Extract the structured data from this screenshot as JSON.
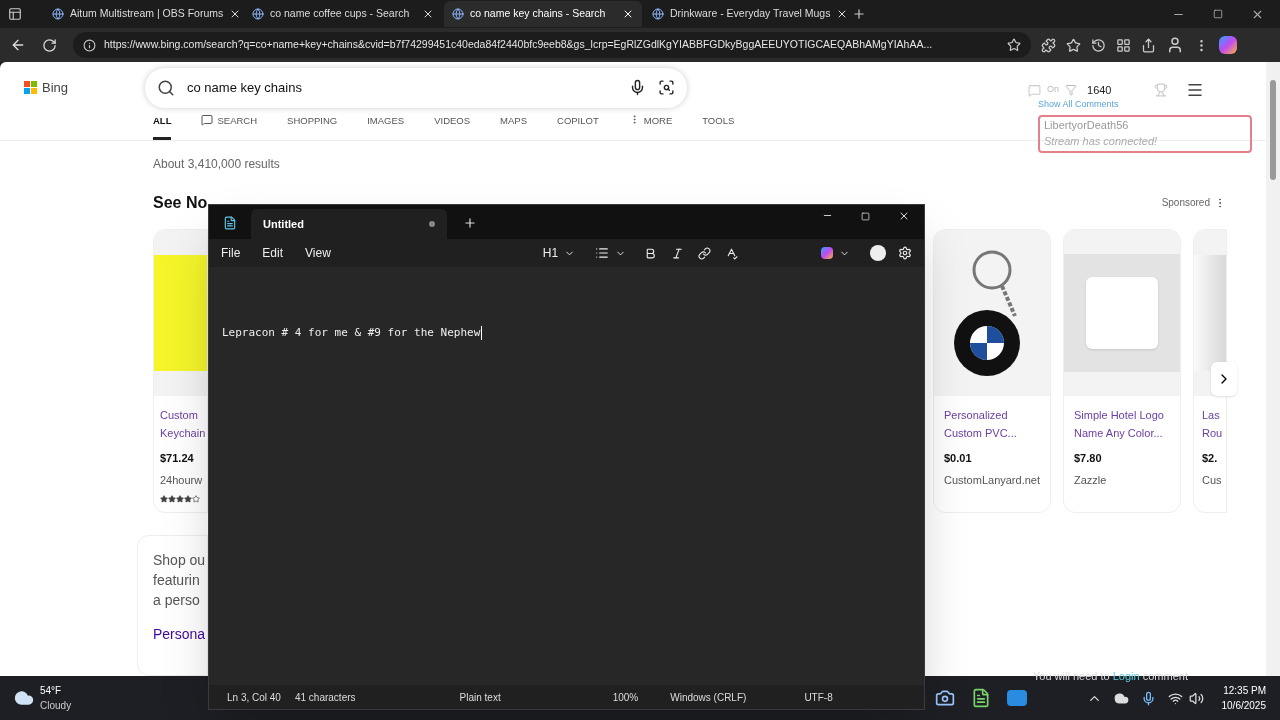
{
  "browser": {
    "tabs": [
      {
        "title": "Aitum Multistream | OBS Forums",
        "selected": false
      },
      {
        "title": "co name coffee cups - Search",
        "selected": false
      },
      {
        "title": "co name key chains - Search",
        "selected": true
      },
      {
        "title": "Drinkware - Everyday Travel Mugs",
        "selected": false
      }
    ],
    "url": "https://www.bing.com/search?q=co+name+key+chains&cvid=b7f74299451c40eda84f2440bfc9eeb8&gs_lcrp=EgRlZGdlKgYIABBFGDkyBggAEEUYOTIGCAEQABhAMgYIAhAA..."
  },
  "bing": {
    "logo": "Bing",
    "query": "co name key chains",
    "nav": [
      {
        "label": "ALL",
        "selected": true
      },
      {
        "label": "SEARCH",
        "selected": false
      },
      {
        "label": "SHOPPING",
        "selected": false
      },
      {
        "label": "IMAGES",
        "selected": false
      },
      {
        "label": "VIDEOS",
        "selected": false
      },
      {
        "label": "MAPS",
        "selected": false
      },
      {
        "label": "COPILOT",
        "selected": false
      },
      {
        "label": "MORE",
        "selected": false
      },
      {
        "label": "TOOLS",
        "selected": false
      }
    ],
    "result_count": "About 3,410,000 results",
    "section_title": "See No",
    "sponsored": "Sponsored",
    "cards": [
      {
        "title": "Custom",
        "title_2": "Keychain",
        "price": "$71.24",
        "seller": "24hourw",
        "stars": 4
      },
      {
        "title": "Personalized",
        "title_2": "Custom PVC...",
        "price": "$0.01",
        "seller": "CustomLanyard.net"
      },
      {
        "title": "Simple Hotel Logo",
        "title_2": "Name Any Color...",
        "price": "$7.80",
        "seller": "Zazzle"
      },
      {
        "title": "Las",
        "title_2": "Rou",
        "price": "$2.",
        "seller": "Cus"
      }
    ],
    "shop_lines": [
      "Shop ou",
      "featurin",
      "a perso"
    ],
    "link": "Persona"
  },
  "overlay": {
    "toggle_label": "On",
    "count": "1640",
    "show_all": "Show All Comments",
    "user": "LibertyorDeath56",
    "message": "Stream has connected!",
    "footer_before": "You will need to ",
    "footer_link": "Login",
    "footer_after": " comment"
  },
  "notepad": {
    "tab_title": "Untitled",
    "unsaved": true,
    "menu": [
      "File",
      "Edit",
      "View"
    ],
    "heading": "H1",
    "text": "Lepracon # 4 for me & #9 for the Nephew",
    "status": [
      "Ln 3, Col 40",
      "41 characters",
      "Plain text",
      "100%",
      "Windows (CRLF)",
      "UTF-8"
    ]
  },
  "taskbar": {
    "temperature": "54°F",
    "weather": "Cloudy",
    "time": "12:35 PM",
    "date": "10/6/2025"
  }
}
